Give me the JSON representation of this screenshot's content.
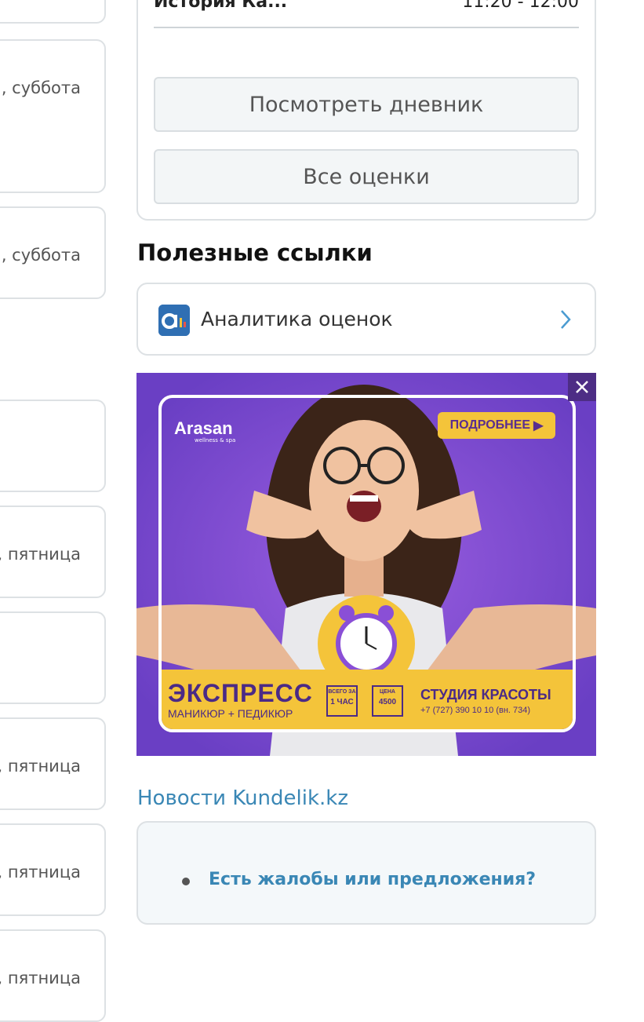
{
  "left_column": {
    "cards": [
      {
        "text": ""
      },
      {
        "text": "., суббота"
      },
      {
        "text": "., суббота"
      },
      {
        "text": ""
      },
      {
        "text": ", пятница"
      },
      {
        "text": ""
      },
      {
        "text": ", пятница"
      },
      {
        "text": ", пятница"
      },
      {
        "text": ", пятница"
      }
    ]
  },
  "diary": {
    "lesson_name": "История Ка...",
    "lesson_time": "11:20 - 12:00",
    "view_diary_label": "Посмотреть дневник",
    "all_grades_label": "Все оценки"
  },
  "useful_links": {
    "title": "Полезные ссылки",
    "items": [
      {
        "label": "Аналитика оценок",
        "icon": "analytics-app-icon"
      }
    ]
  },
  "ad": {
    "brand": "Arasan",
    "brand_sub": "wellness & spa",
    "more_label": "ПОДРОБНЕЕ",
    "title": "ЭКСПРЕСС",
    "subtitle": "МАНИКЮР + ПЕДИКЮР",
    "box1_small": "ВСЕГО ЗА",
    "box1_big": "1 ЧАС",
    "box2_small": "ЦЕНА",
    "box2_big": "4500",
    "studio": "СТУДИЯ КРАСОТЫ",
    "phone": "+7 (727) 390 10 10 (вн. 734)"
  },
  "news": {
    "title": "Новости Kundelik.kz",
    "link_label": "Есть жалобы или предложения?"
  },
  "colors": {
    "accent_link": "#3a87b5",
    "ad_purple": "#7a45cf",
    "ad_yellow": "#f4c43a"
  }
}
